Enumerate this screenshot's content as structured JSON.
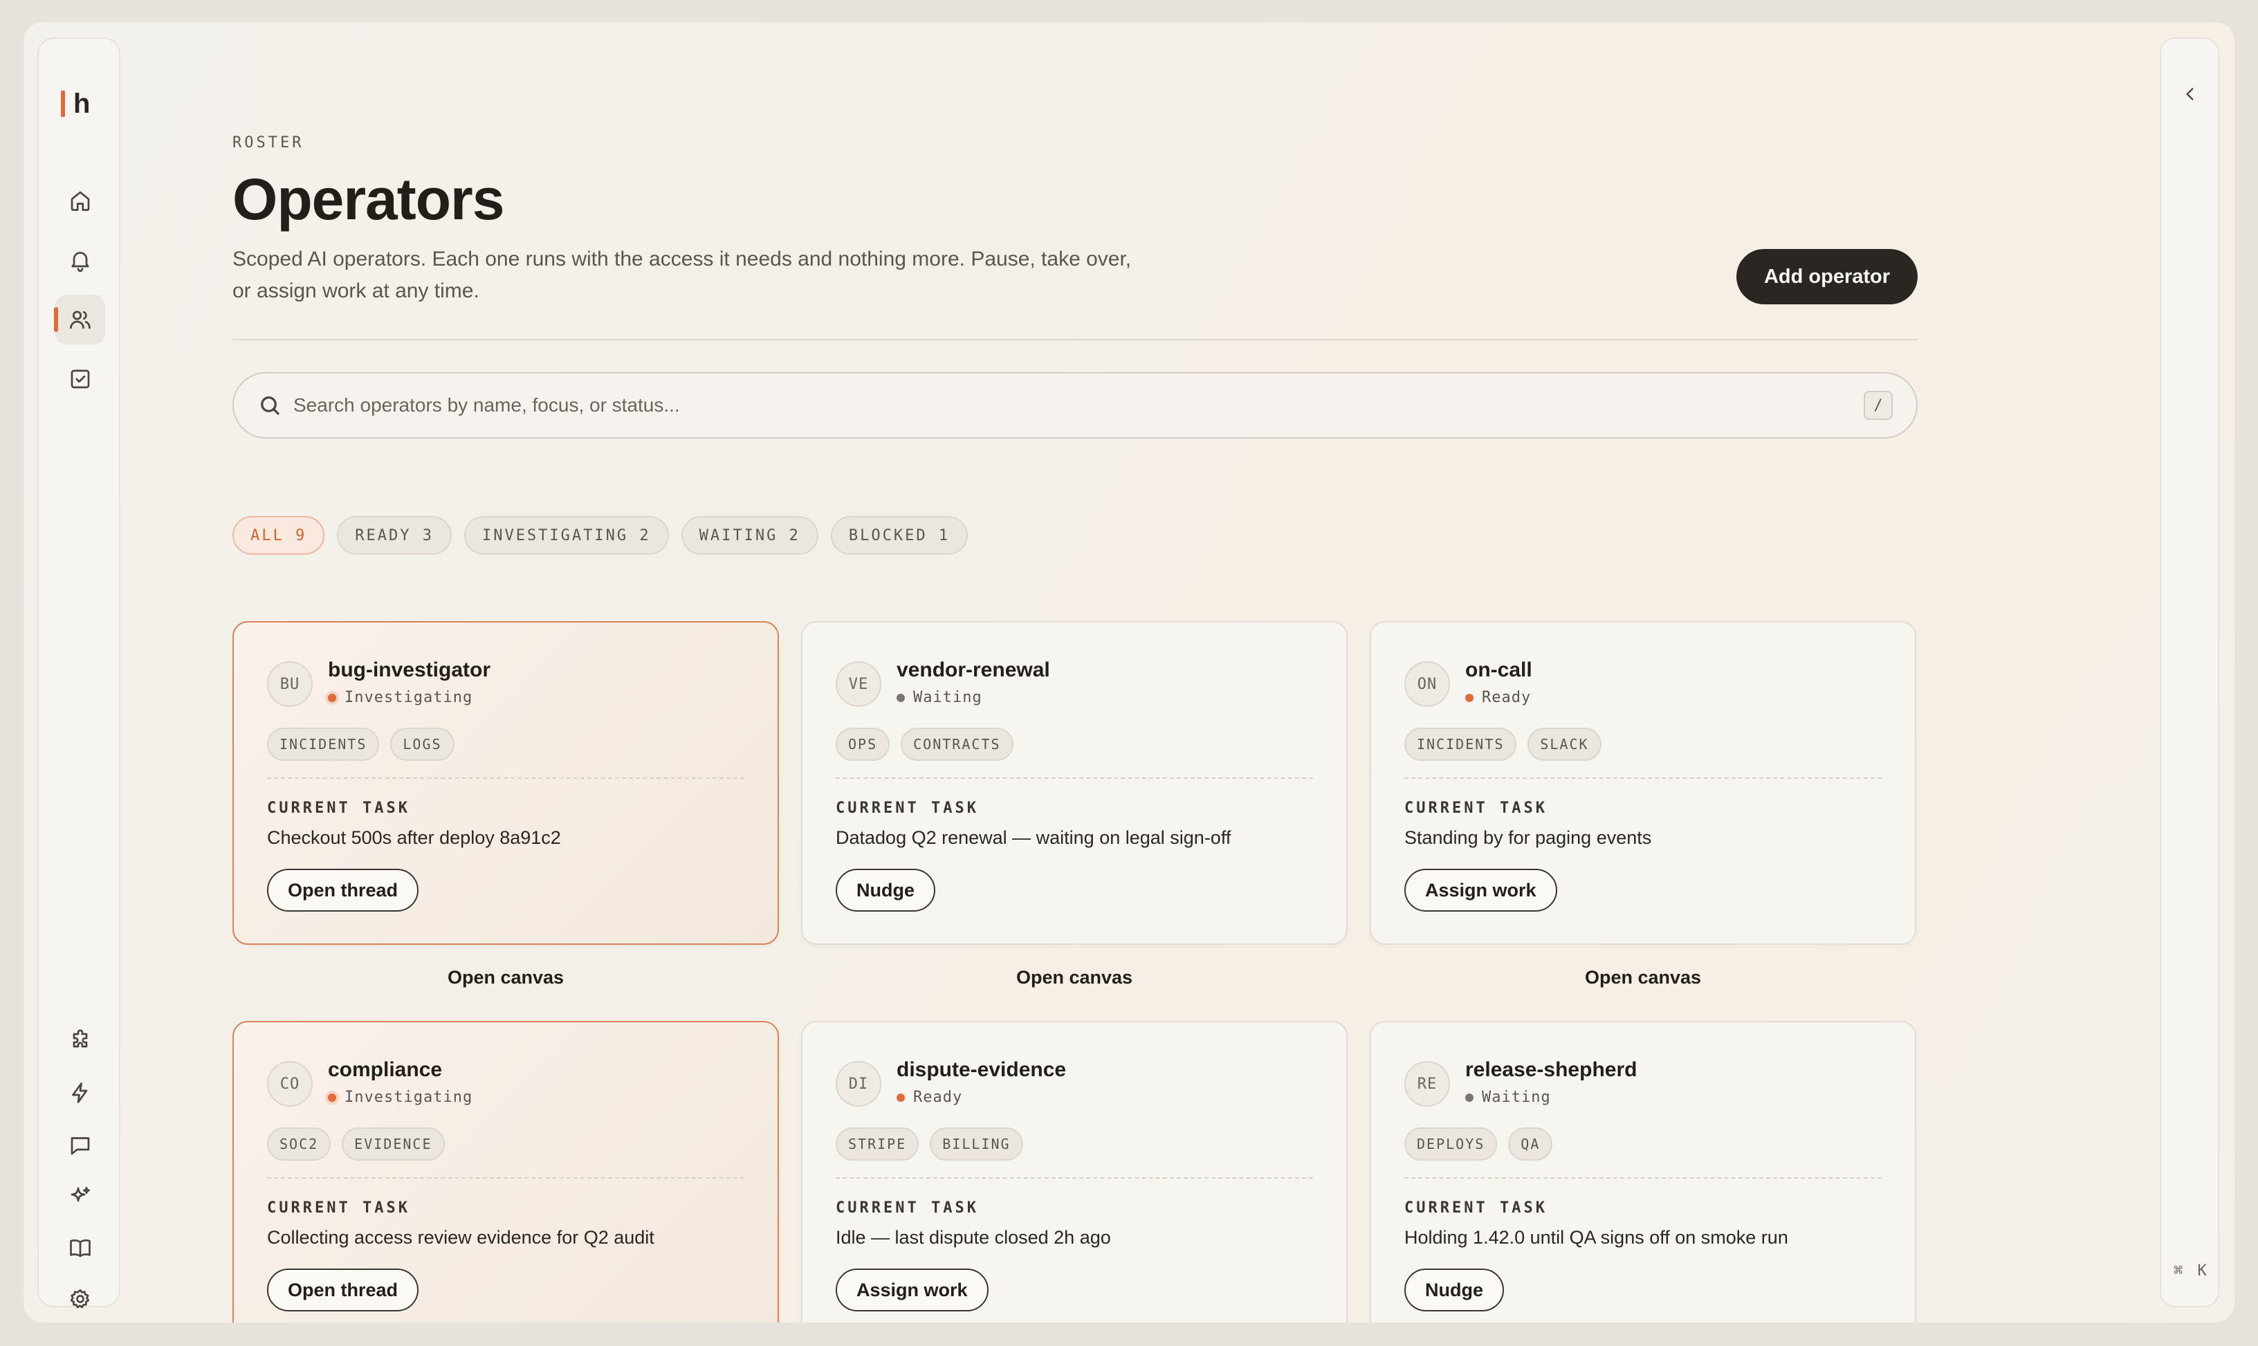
{
  "brand": {
    "logo": "h",
    "accent": "#e2693a"
  },
  "sidebar": {
    "top_items": [
      {
        "name": "home",
        "icon": "home-icon"
      },
      {
        "name": "notifications",
        "icon": "bell-icon"
      },
      {
        "name": "operators",
        "icon": "users-icon",
        "active": true
      },
      {
        "name": "tasks",
        "icon": "checkbox-icon"
      }
    ],
    "bottom_items": [
      {
        "name": "integrations",
        "icon": "puzzle-icon"
      },
      {
        "name": "automations",
        "icon": "lightning-icon"
      },
      {
        "name": "messages",
        "icon": "chat-icon"
      },
      {
        "name": "ai",
        "icon": "sparkles-icon"
      },
      {
        "name": "docs",
        "icon": "book-icon"
      },
      {
        "name": "settings",
        "icon": "gear-icon"
      }
    ]
  },
  "rail": {
    "toggle_icon": "chevron-left-icon",
    "shortcut": "⌘ K"
  },
  "header": {
    "eyebrow": "ROSTER",
    "title": "Operators",
    "subtitle": "Scoped AI operators. Each one runs with the access it needs and nothing more. Pause, take over, or assign work at any time.",
    "add_button": "Add operator"
  },
  "search": {
    "placeholder": "Search operators by name, focus, or status...",
    "value": "",
    "shortcut": "/"
  },
  "filters": [
    {
      "label": "ALL 9",
      "active": true
    },
    {
      "label": "READY 3"
    },
    {
      "label": "INVESTIGATING 2"
    },
    {
      "label": "WAITING 2"
    },
    {
      "label": "BLOCKED 1"
    }
  ],
  "task_label": "CURRENT TASK",
  "open_canvas": "Open canvas",
  "operators": [
    {
      "initials": "BU",
      "name": "bug-investigator",
      "status": "Investigating",
      "tags": [
        "INCIDENTS",
        "LOGS"
      ],
      "task": "Checkout 500s after deploy 8a91c2",
      "action": "Open thread",
      "highlight": true
    },
    {
      "initials": "VE",
      "name": "vendor-renewal",
      "status": "Waiting",
      "tags": [
        "OPS",
        "CONTRACTS"
      ],
      "task": "Datadog Q2 renewal — waiting on legal sign-off",
      "action": "Nudge"
    },
    {
      "initials": "ON",
      "name": "on-call",
      "status": "Ready",
      "tags": [
        "INCIDENTS",
        "SLACK"
      ],
      "task": "Standing by for paging events",
      "action": "Assign work"
    },
    {
      "initials": "CO",
      "name": "compliance",
      "status": "Investigating",
      "tags": [
        "SOC2",
        "EVIDENCE"
      ],
      "task": "Collecting access review evidence for Q2 audit",
      "action": "Open thread",
      "highlight": true
    },
    {
      "initials": "DI",
      "name": "dispute-evidence",
      "status": "Ready",
      "tags": [
        "STRIPE",
        "BILLING"
      ],
      "task": "Idle — last dispute closed 2h ago",
      "action": "Assign work"
    },
    {
      "initials": "RE",
      "name": "release-shepherd",
      "status": "Waiting",
      "tags": [
        "DEPLOYS",
        "QA"
      ],
      "task": "Holding 1.42.0 until QA signs off on smoke run",
      "action": "Nudge"
    }
  ]
}
